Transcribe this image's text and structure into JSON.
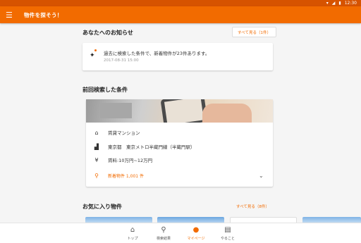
{
  "statusbar": {
    "time": "12:30",
    "icons": [
      "wifi-icon",
      "signal-icon",
      "battery-icon"
    ]
  },
  "appbar": {
    "menu_icon": "hamburger-menu-icon",
    "title": "物件を探そう！"
  },
  "notice": {
    "heading": "あなたへのお知らせ",
    "see_all": "すべて見る（1件）",
    "message": "過去に検索した条件で、新着物件が23件あります。",
    "date": "2017-08-31 15:00",
    "icon": "sparkle-icon"
  },
  "last_search": {
    "heading": "前回検索した条件",
    "rows": [
      {
        "icon": "home-icon",
        "text": "賃貸マンション"
      },
      {
        "icon": "train-icon",
        "text": "東京都　東京メトロ半蔵門線（半蔵門駅）"
      },
      {
        "icon": "yen-icon",
        "text": "賃料:10万円~12万円"
      }
    ],
    "result": {
      "icon": "search-icon",
      "text": "新着物件 1,001 件"
    }
  },
  "favorites": {
    "heading": "お気に入り物件",
    "see_all": "すべて見る（8件）"
  },
  "bottom_nav": [
    {
      "label": "トップ",
      "icon": "home-icon"
    },
    {
      "label": "検索結果",
      "icon": "search-results-icon"
    },
    {
      "label": "マイページ",
      "icon": "person-icon"
    },
    {
      "label": "やること",
      "icon": "clipboard-icon"
    }
  ],
  "colors": {
    "accent": "#f26b00",
    "statusbar": "#d65300",
    "background": "#f5f5f5"
  }
}
